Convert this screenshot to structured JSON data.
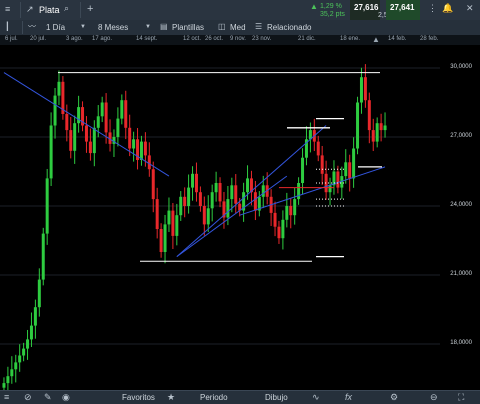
{
  "topbar": {
    "instrument": "Plata",
    "change_pct": "1,29 %",
    "change_pts": "35,2 pts",
    "sell": "27,616",
    "spread": "2,5",
    "buy": "27,641"
  },
  "toolbar": {
    "interval": "1 Día",
    "range": "8 Meses",
    "templates": "Plantillas",
    "indicator": "Med",
    "related": "Relacionado"
  },
  "dates": [
    "6 jul.",
    "20 jul.",
    "3 ago.",
    "17 ago.",
    "14 sept.",
    "12 oct.",
    "26 oct.",
    "9 nov.",
    "23 nov.",
    "21 dic.",
    "18 ene.",
    "14 feb.",
    "28 feb."
  ],
  "price_labels": [
    "30,0000",
    "27,0000",
    "24,0000",
    "21,0000",
    "18,0000"
  ],
  "bottom": {
    "favorites": "Favoritos",
    "period": "Periodo",
    "drawing": "Dibujo"
  },
  "colors": {
    "up": "#2ecc40",
    "down": "#e8282b",
    "trendline": "#3355dd",
    "accent": "#4cc35a"
  },
  "chart_data": {
    "type": "candlestick",
    "ylim": [
      16,
      31
    ],
    "closes": [
      16.3,
      16.6,
      16.9,
      17.2,
      17.5,
      17.8,
      18.2,
      18.8,
      19.6,
      20.8,
      22.8,
      25.2,
      27.5,
      28.8,
      29.4,
      28.0,
      27.3,
      26.4,
      27.6,
      28.3,
      27.5,
      26.8,
      26.3,
      27.4,
      27.9,
      28.5,
      27.2,
      26.7,
      27.0,
      27.8,
      28.6,
      27.4,
      26.5,
      26.9,
      26.0,
      26.8,
      26.2,
      25.6,
      24.3,
      23.0,
      22.0,
      23.2,
      23.8,
      22.7,
      23.6,
      24.4,
      24.0,
      24.8,
      25.4,
      24.6,
      24.0,
      23.2,
      23.9,
      24.6,
      25.0,
      24.2,
      23.5,
      24.3,
      24.9,
      24.1,
      23.8,
      24.6,
      25.2,
      24.6,
      23.8,
      24.4,
      24.9,
      24.4,
      23.7,
      23.1,
      22.6,
      23.4,
      24.0,
      23.6,
      24.3,
      25.0,
      26.1,
      26.9,
      27.3,
      26.8,
      26.2,
      25.4,
      24.6,
      24.9,
      25.5,
      24.8,
      25.3,
      25.9,
      25.2,
      26.5,
      28.5,
      29.6,
      28.6,
      27.3,
      26.8,
      27.6,
      27.3,
      27.5
    ],
    "horizontal_levels": [
      29.8,
      21.6
    ],
    "trendlines": [
      {
        "from": [
          0,
          29.8
        ],
        "to": [
          42,
          25.3
        ]
      },
      {
        "from": [
          44,
          21.8
        ],
        "to": [
          72,
          25.3
        ]
      }
    ]
  }
}
